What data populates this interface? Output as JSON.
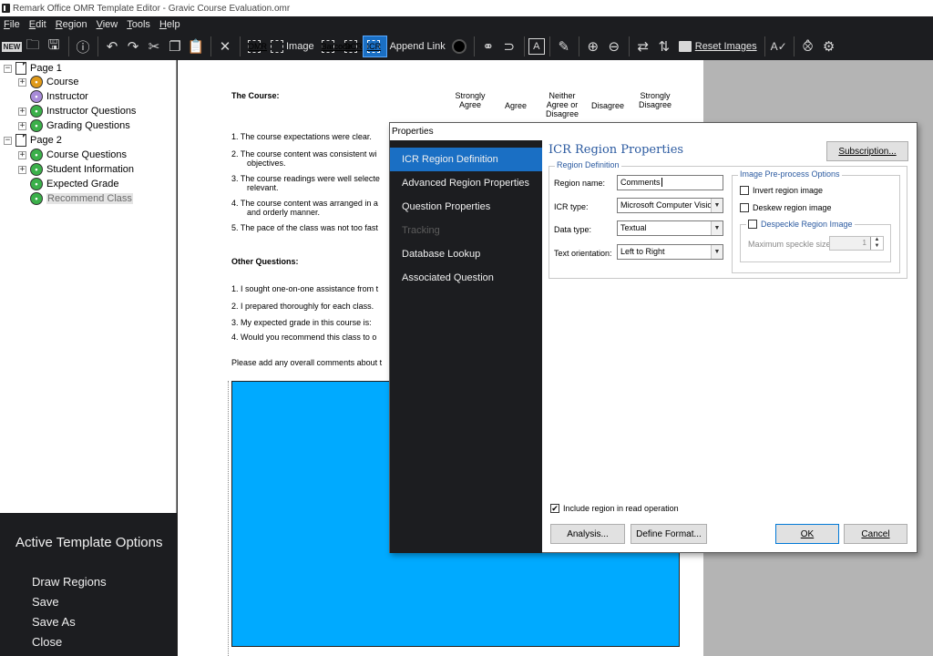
{
  "window": {
    "title": "Remark Office OMR Template Editor - Gravic Course Evaluation.omr"
  },
  "menu": [
    "File",
    "Edit",
    "Region",
    "View",
    "Tools",
    "Help"
  ],
  "toolbar": {
    "omr": "OMR",
    "image": "Image",
    "barcode": "Barcode",
    "ocr": "OCR",
    "icr": "ICR",
    "append_link": "Append Link",
    "reset_images": "Reset Images"
  },
  "tree": [
    {
      "label": "Page 1",
      "type": "page",
      "expander": "−"
    },
    {
      "label": "Course",
      "type": "q",
      "color": "#e09a1a",
      "expander": "+"
    },
    {
      "label": "Instructor",
      "type": "q",
      "color": "#a88bd8",
      "expander": ""
    },
    {
      "label": "Instructor Questions",
      "type": "q",
      "color": "#3bb04a",
      "expander": "+"
    },
    {
      "label": "Grading Questions",
      "type": "q",
      "color": "#3bb04a",
      "expander": "+"
    },
    {
      "label": "Page 2",
      "type": "page",
      "expander": "−"
    },
    {
      "label": "Course Questions",
      "type": "q",
      "color": "#3bb04a",
      "expander": "+"
    },
    {
      "label": "Student Information",
      "type": "q",
      "color": "#3bb04a",
      "expander": "+"
    },
    {
      "label": "Expected Grade",
      "type": "q",
      "color": "#3bb04a",
      "expander": ""
    },
    {
      "label": "Recommend Class",
      "type": "q",
      "color": "#3bb04a",
      "expander": ""
    }
  ],
  "options": {
    "title": "Active Template Options",
    "items": [
      "Draw Regions",
      "Save",
      "Save As",
      "Close"
    ]
  },
  "document": {
    "course_heading": "The Course:",
    "col_strongly_agree": "Strongly Agree",
    "col_agree": "Agree",
    "col_neither": "Neither Agree or Disagree",
    "col_disagree": "Disagree",
    "col_strongly_disagree": "Strongly Disagree",
    "q1": "1.   The course expectations were clear.",
    "q2a": "2.   The course content was consistent wi",
    "q2b": "objectives.",
    "q3a": "3.   The course readings were well selecte",
    "q3b": "relevant.",
    "q4a": "4.   The course content was arranged in a",
    "q4b": "and orderly manner.",
    "q5": "5.   The pace of the class was not too fast",
    "other_heading": "Other Questions:",
    "o1": "1.   I sought one-on-one assistance from t",
    "o2": "2.   I prepared thoroughly for each class.",
    "o3": "3.   My expected grade in this course is:",
    "o4": "4.   Would you recommend this class to o",
    "comments_prompt": "Please add any overall comments about t",
    "region_color": "#00aaff"
  },
  "dialog": {
    "title": "Properties",
    "nav": [
      {
        "label": "ICR Region Definition",
        "state": "active"
      },
      {
        "label": "Advanced Region Properties",
        "state": "normal"
      },
      {
        "label": "Question Properties",
        "state": "normal"
      },
      {
        "label": "Tracking",
        "state": "disabled"
      },
      {
        "label": "Database Lookup",
        "state": "normal"
      },
      {
        "label": "Associated Question",
        "state": "normal"
      }
    ],
    "heading": "ICR Region Properties",
    "subscription_button": "Subscription...",
    "region_definition_group": "Region Definition",
    "region_name_label": "Region name:",
    "region_name_value": "Comments",
    "icr_type_label": "ICR type:",
    "icr_type_value": "Microsoft Computer Vision",
    "data_type_label": "Data type:",
    "data_type_value": "Textual",
    "text_orientation_label": "Text orientation:",
    "text_orientation_value": "Left to Right",
    "preprocess_group": "Image Pre-process Options",
    "invert_label": "Invert region image",
    "invert_checked": false,
    "deskew_label": "Deskew region image",
    "deskew_checked": false,
    "despeckle_label": "Despeckle Region Image",
    "despeckle_checked": false,
    "speckle_label": "Maximum speckle size:",
    "speckle_value": "1",
    "include_label": "Include region in read operation",
    "include_checked": true,
    "analysis_button": "Analysis...",
    "define_format_button": "Define Format...",
    "ok_button": "OK",
    "cancel_button": "Cancel"
  },
  "colors": {
    "accent": "#1a6fc4",
    "dark_bg": "#1c1d20",
    "heading_blue": "#2b5aa0"
  }
}
